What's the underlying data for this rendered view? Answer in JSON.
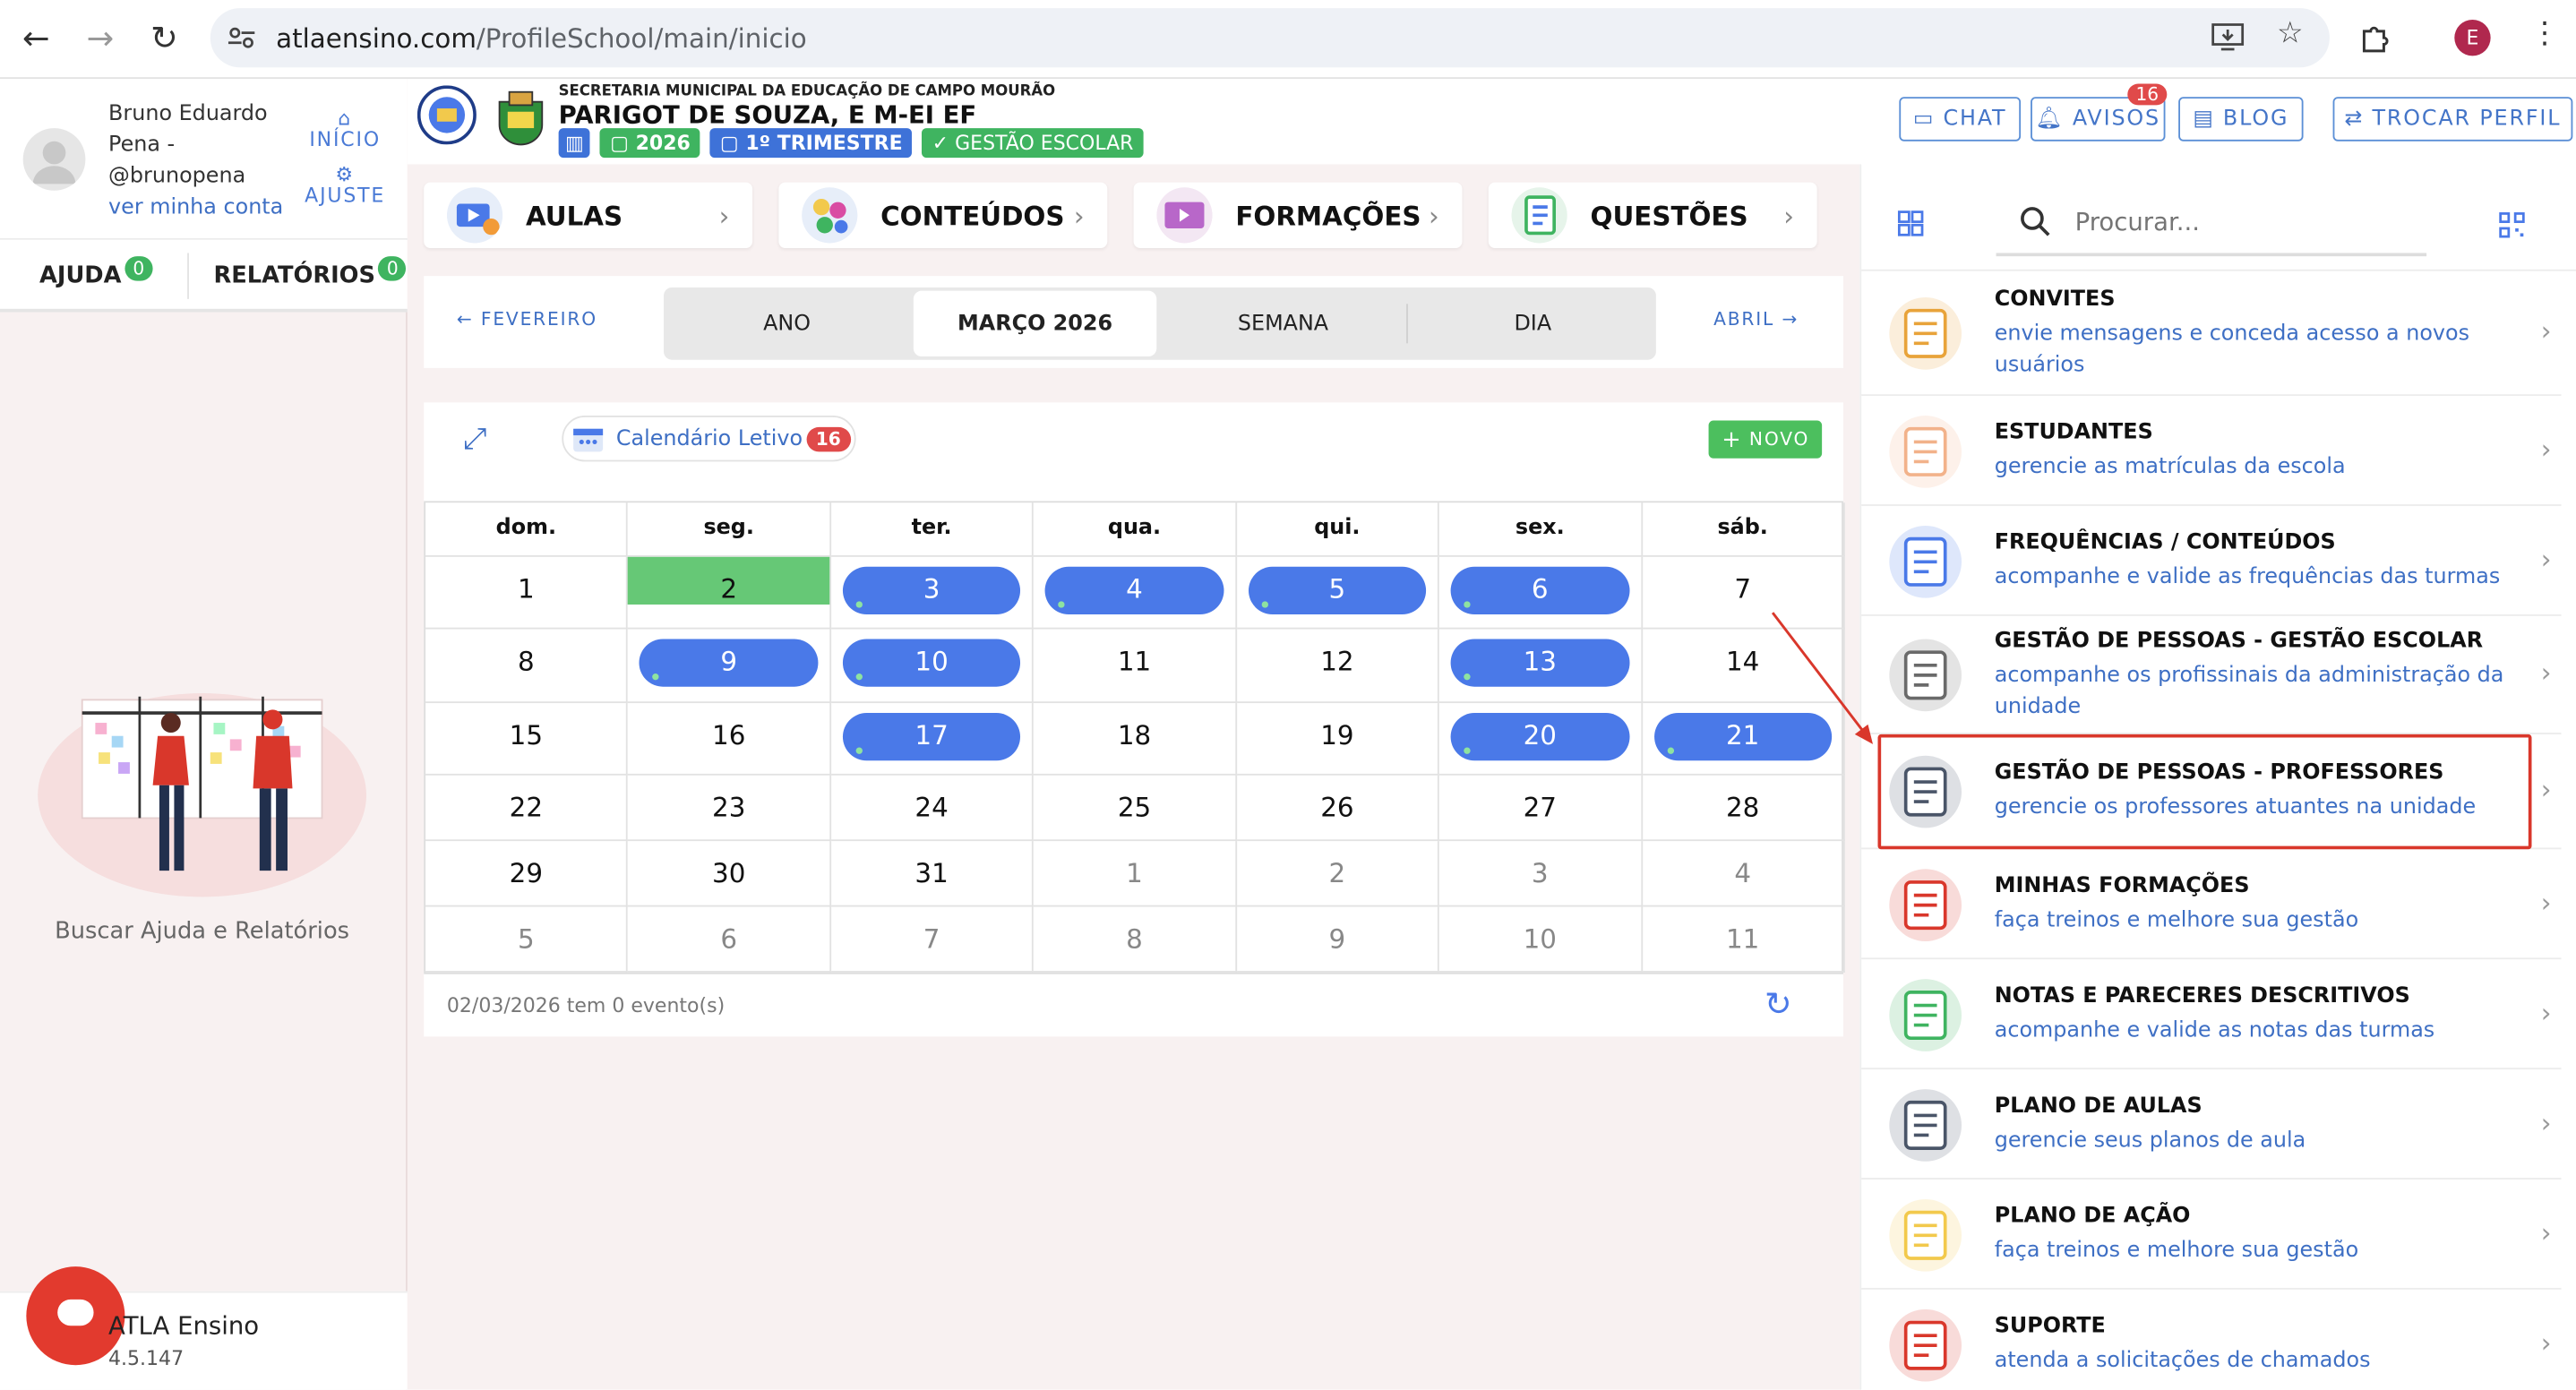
{
  "browser": {
    "url_domain": "atlaensino.com",
    "url_path": "/ProfileSchool/main/inicio",
    "profile_initial": "E"
  },
  "user": {
    "name_line1": "Bruno Eduardo",
    "name_line2": "Pena -",
    "handle": "@brunopena",
    "account_link": "ver minha conta",
    "inicio": "INÍCIO",
    "ajuste": "AJUSTE"
  },
  "left_tabs": [
    {
      "label": "AJUDA",
      "count": "0"
    },
    {
      "label": "RELATÓRIOS",
      "count": "0"
    }
  ],
  "help_caption": "Buscar Ajuda e Relatórios",
  "atla": {
    "name": "ATLA Ensino",
    "version": "4.5.147"
  },
  "header": {
    "secretaria": "SECRETARIA MUNICIPAL DA EDUCAÇÃO DE CAMPO MOURÃO",
    "school": "PARIGOT DE SOUZA, E M-EI EF",
    "year": "2026",
    "term": "1º TRIMESTRE",
    "role": "GESTÃO ESCOLAR",
    "chat": "CHAT",
    "avisos": "AVISOS",
    "avisos_count": "16",
    "blog": "BLOG",
    "trocar": "TROCAR PERFIL"
  },
  "main_tabs": [
    {
      "label": "AULAS"
    },
    {
      "label": "CONTEÚDOS"
    },
    {
      "label": "FORMAÇÕES"
    },
    {
      "label": "QUESTÕES"
    }
  ],
  "period": {
    "prev": "FEVEREIRO",
    "next": "ABRIL",
    "views": [
      "ANO",
      "MARÇO 2026",
      "SEMANA",
      "DIA"
    ],
    "active_view": "MARÇO 2026"
  },
  "calendar": {
    "name": "Calendário Letivo",
    "count": "16",
    "new_button": "NOVO",
    "weekdays": [
      "dom.",
      "seg.",
      "ter.",
      "qua.",
      "qui.",
      "sex.",
      "sáb."
    ],
    "weeks": [
      [
        "1",
        "2",
        "3",
        "4",
        "5",
        "6",
        "7"
      ],
      [
        "8",
        "9",
        "10",
        "11",
        "12",
        "13",
        "14"
      ],
      [
        "15",
        "16",
        "17",
        "18",
        "19",
        "20",
        "21"
      ],
      [
        "22",
        "23",
        "24",
        "25",
        "26",
        "27",
        "28"
      ],
      [
        "29",
        "30",
        "31",
        "1",
        "2",
        "3",
        "4"
      ],
      [
        "5",
        "6",
        "7",
        "8",
        "9",
        "10",
        "11"
      ]
    ],
    "today": "2",
    "event_days": [
      "3",
      "4",
      "5",
      "6",
      "9",
      "10",
      "13",
      "17",
      "20",
      "21"
    ],
    "footer": "02/03/2026 tem 0 evento(s)"
  },
  "right_panel": {
    "search_placeholder": "Procurar...",
    "items": [
      {
        "title": "CONVITES",
        "desc": "envie mensagens e conceda acesso a novos usuários",
        "icon": "medal-icon"
      },
      {
        "title": "ESTUDANTES",
        "desc": "gerencie as matrículas da escola",
        "icon": "students-icon"
      },
      {
        "title": "FREQUÊNCIAS / CONTEÚDOS",
        "desc": "acompanhe e valide as frequências das turmas",
        "icon": "attendance-icon"
      },
      {
        "title": "GESTÃO DE PESSOAS - GESTÃO ESCOLAR",
        "desc": "acompanhe os profissinais da administração da unidade",
        "icon": "staff-growth-icon"
      },
      {
        "title": "GESTÃO DE PESSOAS - PROFESSORES",
        "desc": "gerencie os professores atuantes na unidade",
        "icon": "teachers-icon"
      },
      {
        "title": "MINHAS FORMAÇÕES",
        "desc": "faça treinos e melhore sua gestão",
        "icon": "certificate-icon"
      },
      {
        "title": "NOTAS E PARECERES DESCRITIVOS",
        "desc": "acompanhe e valide as notas das turmas",
        "icon": "grades-icon"
      },
      {
        "title": "PLANO DE AULAS",
        "desc": "gerencie seus planos de aula",
        "icon": "lesson-plan-icon"
      },
      {
        "title": "PLANO DE AÇÃO",
        "desc": "faça treinos e melhore sua gestão",
        "icon": "action-plan-icon"
      },
      {
        "title": "SUPORTE",
        "desc": "atenda a solicitações de chamados",
        "icon": "support-icon"
      }
    ]
  },
  "colors": {
    "accent_blue": "#4a79e8",
    "green": "#3fb460",
    "highlight_red": "#d9372b",
    "badge_red": "#e04a4a"
  }
}
